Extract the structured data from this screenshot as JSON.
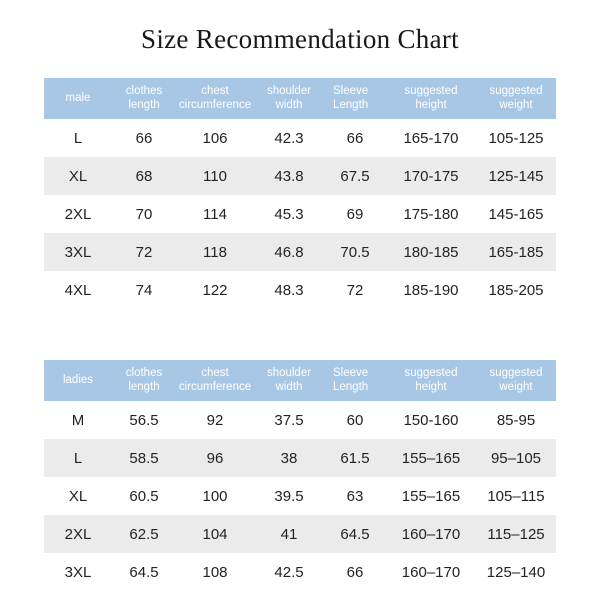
{
  "title": "Size Recommendation Chart",
  "colors": {
    "header_background": "#a8c7e5",
    "header_text": "#ffffff",
    "row_alt_background": "#ebebeb",
    "row_background": "#ffffff",
    "body_text": "#232323",
    "title_text": "#191919",
    "page_background": "#ffffff"
  },
  "tables": [
    {
      "id": "male",
      "headers": [
        "male",
        "clothes length",
        "chest circumference",
        "shoulder width",
        "Sleeve Length",
        "suggested height",
        "suggested weight"
      ],
      "rows": [
        {
          "size": "L",
          "clothes_length": "66",
          "chest_circumference": "106",
          "shoulder_width": "42.3",
          "sleeve_length": "66",
          "suggested_height": "165-170",
          "suggested_weight": "105-125"
        },
        {
          "size": "XL",
          "clothes_length": "68",
          "chest_circumference": "110",
          "shoulder_width": "43.8",
          "sleeve_length": "67.5",
          "suggested_height": "170-175",
          "suggested_weight": "125-145"
        },
        {
          "size": "2XL",
          "clothes_length": "70",
          "chest_circumference": "114",
          "shoulder_width": "45.3",
          "sleeve_length": "69",
          "suggested_height": "175-180",
          "suggested_weight": "145-165"
        },
        {
          "size": "3XL",
          "clothes_length": "72",
          "chest_circumference": "118",
          "shoulder_width": "46.8",
          "sleeve_length": "70.5",
          "suggested_height": "180-185",
          "suggested_weight": "165-185"
        },
        {
          "size": "4XL",
          "clothes_length": "74",
          "chest_circumference": "122",
          "shoulder_width": "48.3",
          "sleeve_length": "72",
          "suggested_height": "185-190",
          "suggested_weight": "185-205"
        }
      ]
    },
    {
      "id": "ladies",
      "headers": [
        "ladies",
        "clothes length",
        "chest circumference",
        "shoulder width",
        "Sleeve Length",
        "suggested height",
        "suggested weight"
      ],
      "rows": [
        {
          "size": "M",
          "clothes_length": "56.5",
          "chest_circumference": "92",
          "shoulder_width": "37.5",
          "sleeve_length": "60",
          "suggested_height": "150-160",
          "suggested_weight": "85-95"
        },
        {
          "size": "L",
          "clothes_length": "58.5",
          "chest_circumference": "96",
          "shoulder_width": "38",
          "sleeve_length": "61.5",
          "suggested_height": "155–165",
          "suggested_weight": "95–105"
        },
        {
          "size": "XL",
          "clothes_length": "60.5",
          "chest_circumference": "100",
          "shoulder_width": "39.5",
          "sleeve_length": "63",
          "suggested_height": "155–165",
          "suggested_weight": "105–115"
        },
        {
          "size": "2XL",
          "clothes_length": "62.5",
          "chest_circumference": "104",
          "shoulder_width": "41",
          "sleeve_length": "64.5",
          "suggested_height": "160–170",
          "suggested_weight": "115–125"
        },
        {
          "size": "3XL",
          "clothes_length": "64.5",
          "chest_circumference": "108",
          "shoulder_width": "42.5",
          "sleeve_length": "66",
          "suggested_height": "160–170",
          "suggested_weight": "125–140"
        }
      ]
    }
  ]
}
